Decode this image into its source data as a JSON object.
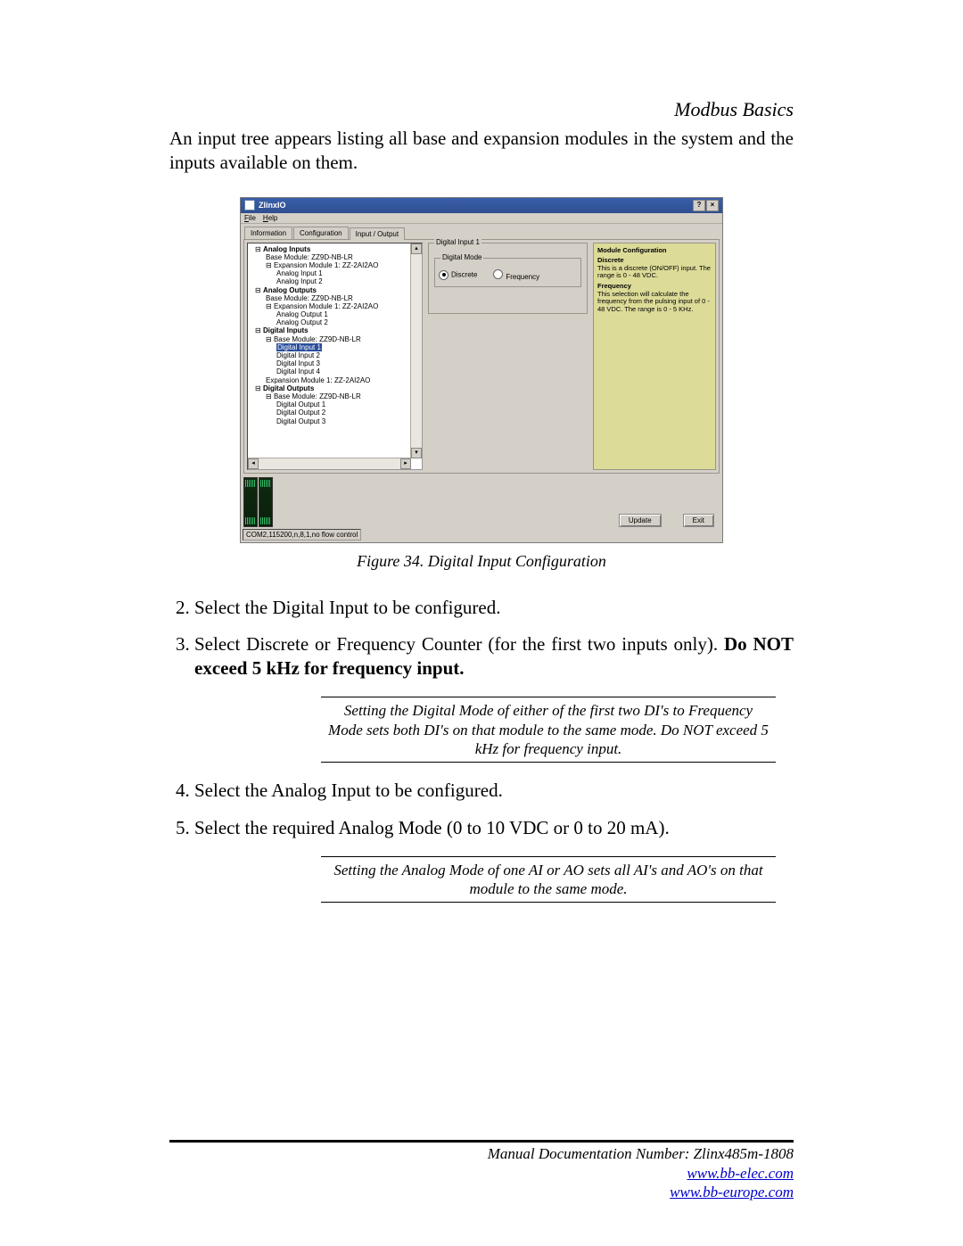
{
  "header": {
    "title": "Modbus Basics"
  },
  "intro": "An input tree appears listing all base and expansion modules in the system and the inputs available on them.",
  "win": {
    "title": "ZlinxIO",
    "menus": [
      "File",
      "Help"
    ],
    "tabs": [
      "Information",
      "Configuration",
      "Input / Output"
    ],
    "active_tab": 2,
    "group_outer": "Digital Input 1",
    "group_inner": "Digital Mode",
    "radio_discrete": "Discrete",
    "radio_frequency": "Frequency",
    "help_title": "Module Configuration",
    "help_h1": "Discrete",
    "help_t1": "This is a discrete (ON/OFF) input. The range is 0 - 48 VDC.",
    "help_h2": "Frequency",
    "help_t2": "This selection will calculate the frequency from the pulsing input of 0 - 48 VDC. The range is 0 - 5 KHz.",
    "btn_update": "Update",
    "btn_exit": "Exit",
    "status": "COM2,115200,n,8,1,no flow control",
    "tree": {
      "ai": "Analog Inputs",
      "ai_base": "Base Module: ZZ9D-NB-LR",
      "ai_exp": "Expansion Module 1: ZZ-2AI2AO",
      "ai1": "Analog Input 1",
      "ai2": "Analog Input 2",
      "ao": "Analog Outputs",
      "ao_base": "Base Module: ZZ9D-NB-LR",
      "ao_exp": "Expansion Module 1: ZZ-2AI2AO",
      "ao1": "Analog Output 1",
      "ao2": "Analog Output 2",
      "di": "Digital Inputs",
      "di_base": "Base Module: ZZ9D-NB-LR",
      "di1": "Digital Input 1",
      "di2": "Digital Input 2",
      "di3": "Digital Input 3",
      "di4": "Digital Input 4",
      "di_exp": "Expansion Module 1: ZZ-2AI2AO",
      "do": "Digital Outputs",
      "do_base": "Base Module: ZZ9D-NB-LR",
      "do1": "Digital Output 1",
      "do2": "Digital Output 2",
      "do3": "Digital Output 3"
    }
  },
  "figcaption": "Figure 34.      Digital Input Configuration",
  "steps": {
    "s2": "Select the Digital Input to be configured.",
    "s3a": "Select Discrete or Frequency Counter (for the first two inputs only).  ",
    "s3b": "Do NOT exceed 5 kHz for frequency input.",
    "s4": "Select the Analog Input to be configured.",
    "s5": "Select the required Analog Mode (0 to 10 VDC or 0 to 20 mA)."
  },
  "note1": "Setting the Digital Mode of either of the first two DI's to Frequency Mode sets both DI's on that module to the same mode.  Do NOT exceed 5 kHz for frequency input.",
  "note2": "Setting the Analog Mode of one AI or AO sets all AI's and AO's on that module to the same mode.",
  "footer": {
    "doc": "Manual Documentation Number: Zlinx485m-1808",
    "url1": "www.bb-elec.com",
    "url2": "www.bb-europe.com"
  }
}
